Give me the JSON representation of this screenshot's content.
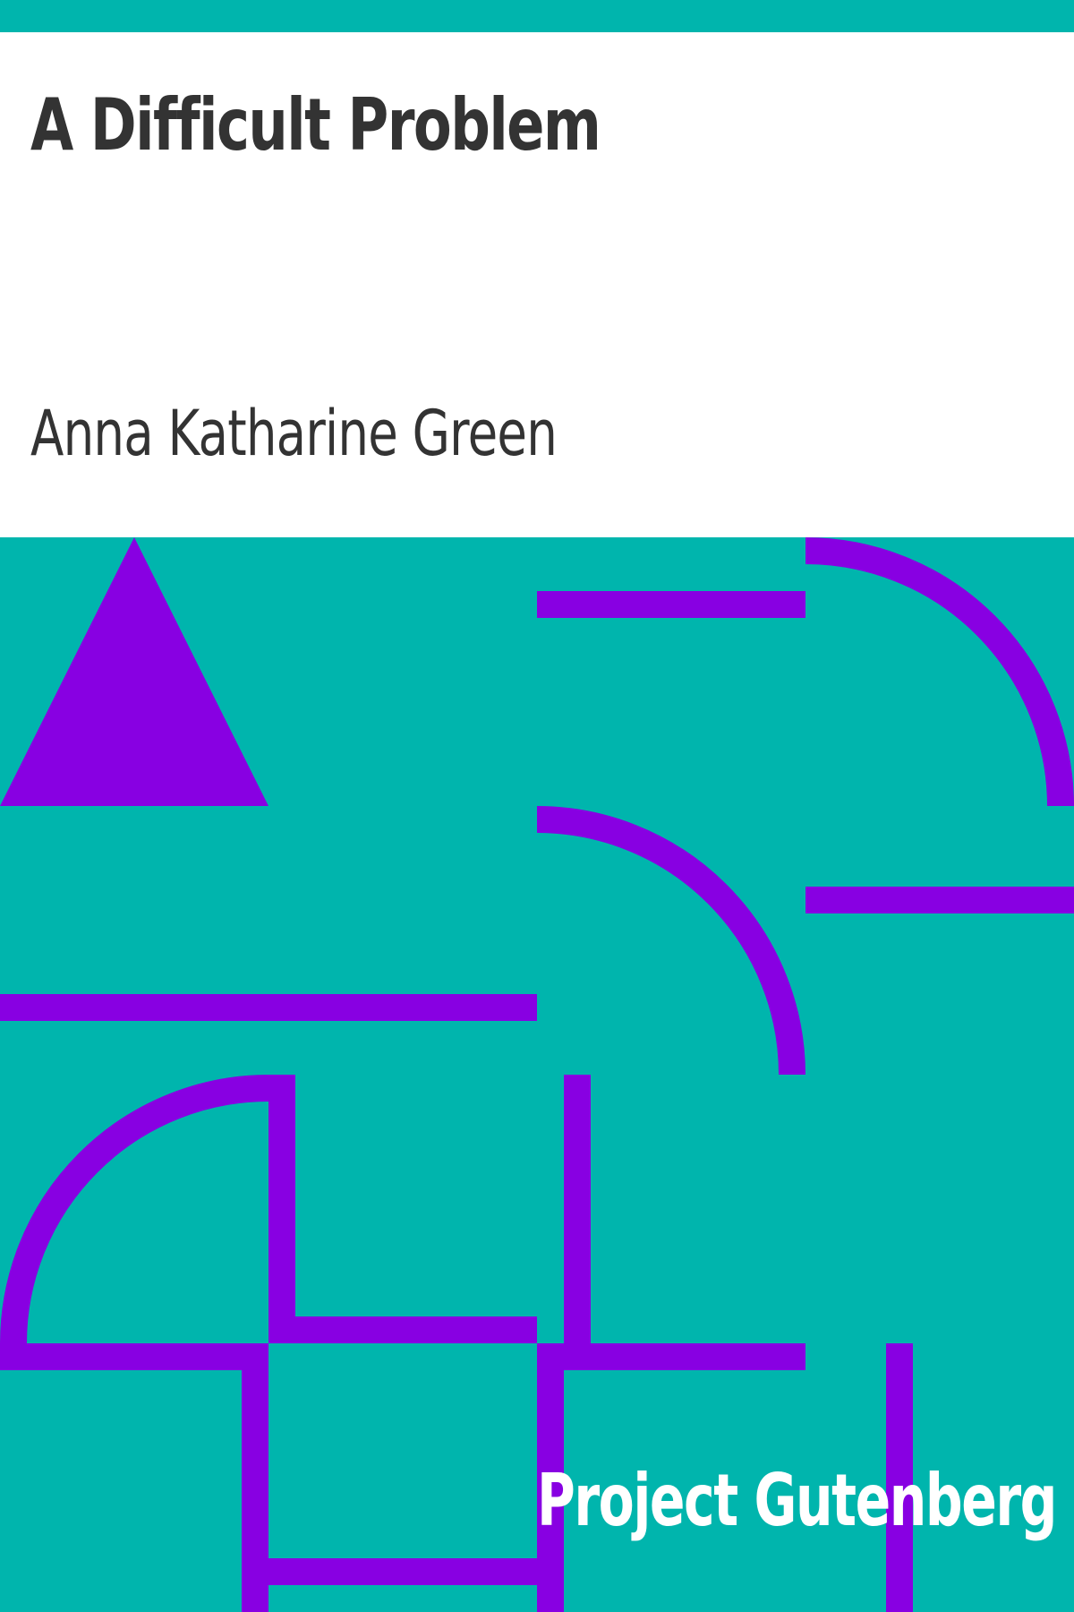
{
  "cover": {
    "title": "A Difficult Problem",
    "author": "Anna Katharine Green",
    "publisher": "Project Gutenberg"
  },
  "colors": {
    "background_teal": "#00b5ad",
    "shape_purple": "#8800e2",
    "text_dark": "#333333",
    "panel_white": "#ffffff",
    "publisher_text": "#ffffff"
  }
}
